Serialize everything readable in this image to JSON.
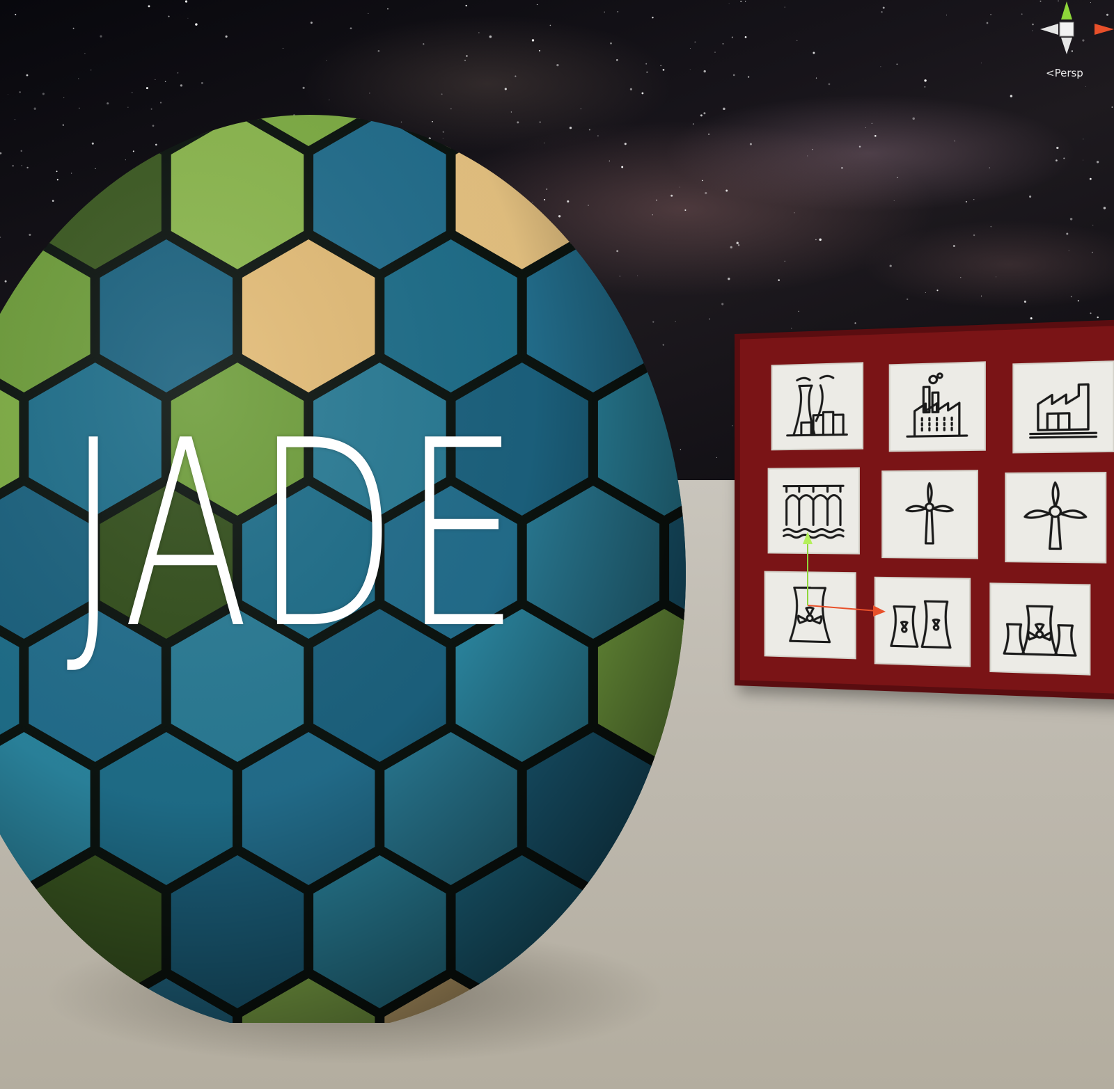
{
  "title": "JADE",
  "view": {
    "projection_label": "Persp",
    "back_glyph": "<"
  },
  "energy_panel": {
    "tiles": [
      {
        "icon": "coal-power-plant-icon"
      },
      {
        "icon": "factory-icon"
      },
      {
        "icon": "industrial-building-icon"
      },
      {
        "icon": "hydroelectric-dam-icon"
      },
      {
        "icon": "small-wind-turbine-icon"
      },
      {
        "icon": "large-wind-turbine-icon"
      },
      {
        "icon": "nuclear-plant-single-icon"
      },
      {
        "icon": "nuclear-plant-double-icon"
      },
      {
        "icon": "nuclear-plant-triple-icon"
      }
    ]
  },
  "colors": {
    "panel_frame": "#7a1416",
    "water": "#1f6f8b",
    "grass": "#7fae45",
    "forest": "#3c5a22",
    "sand": "#e9c583",
    "gizmo_x": "#e8502a",
    "gizmo_y": "#8ed63a"
  }
}
